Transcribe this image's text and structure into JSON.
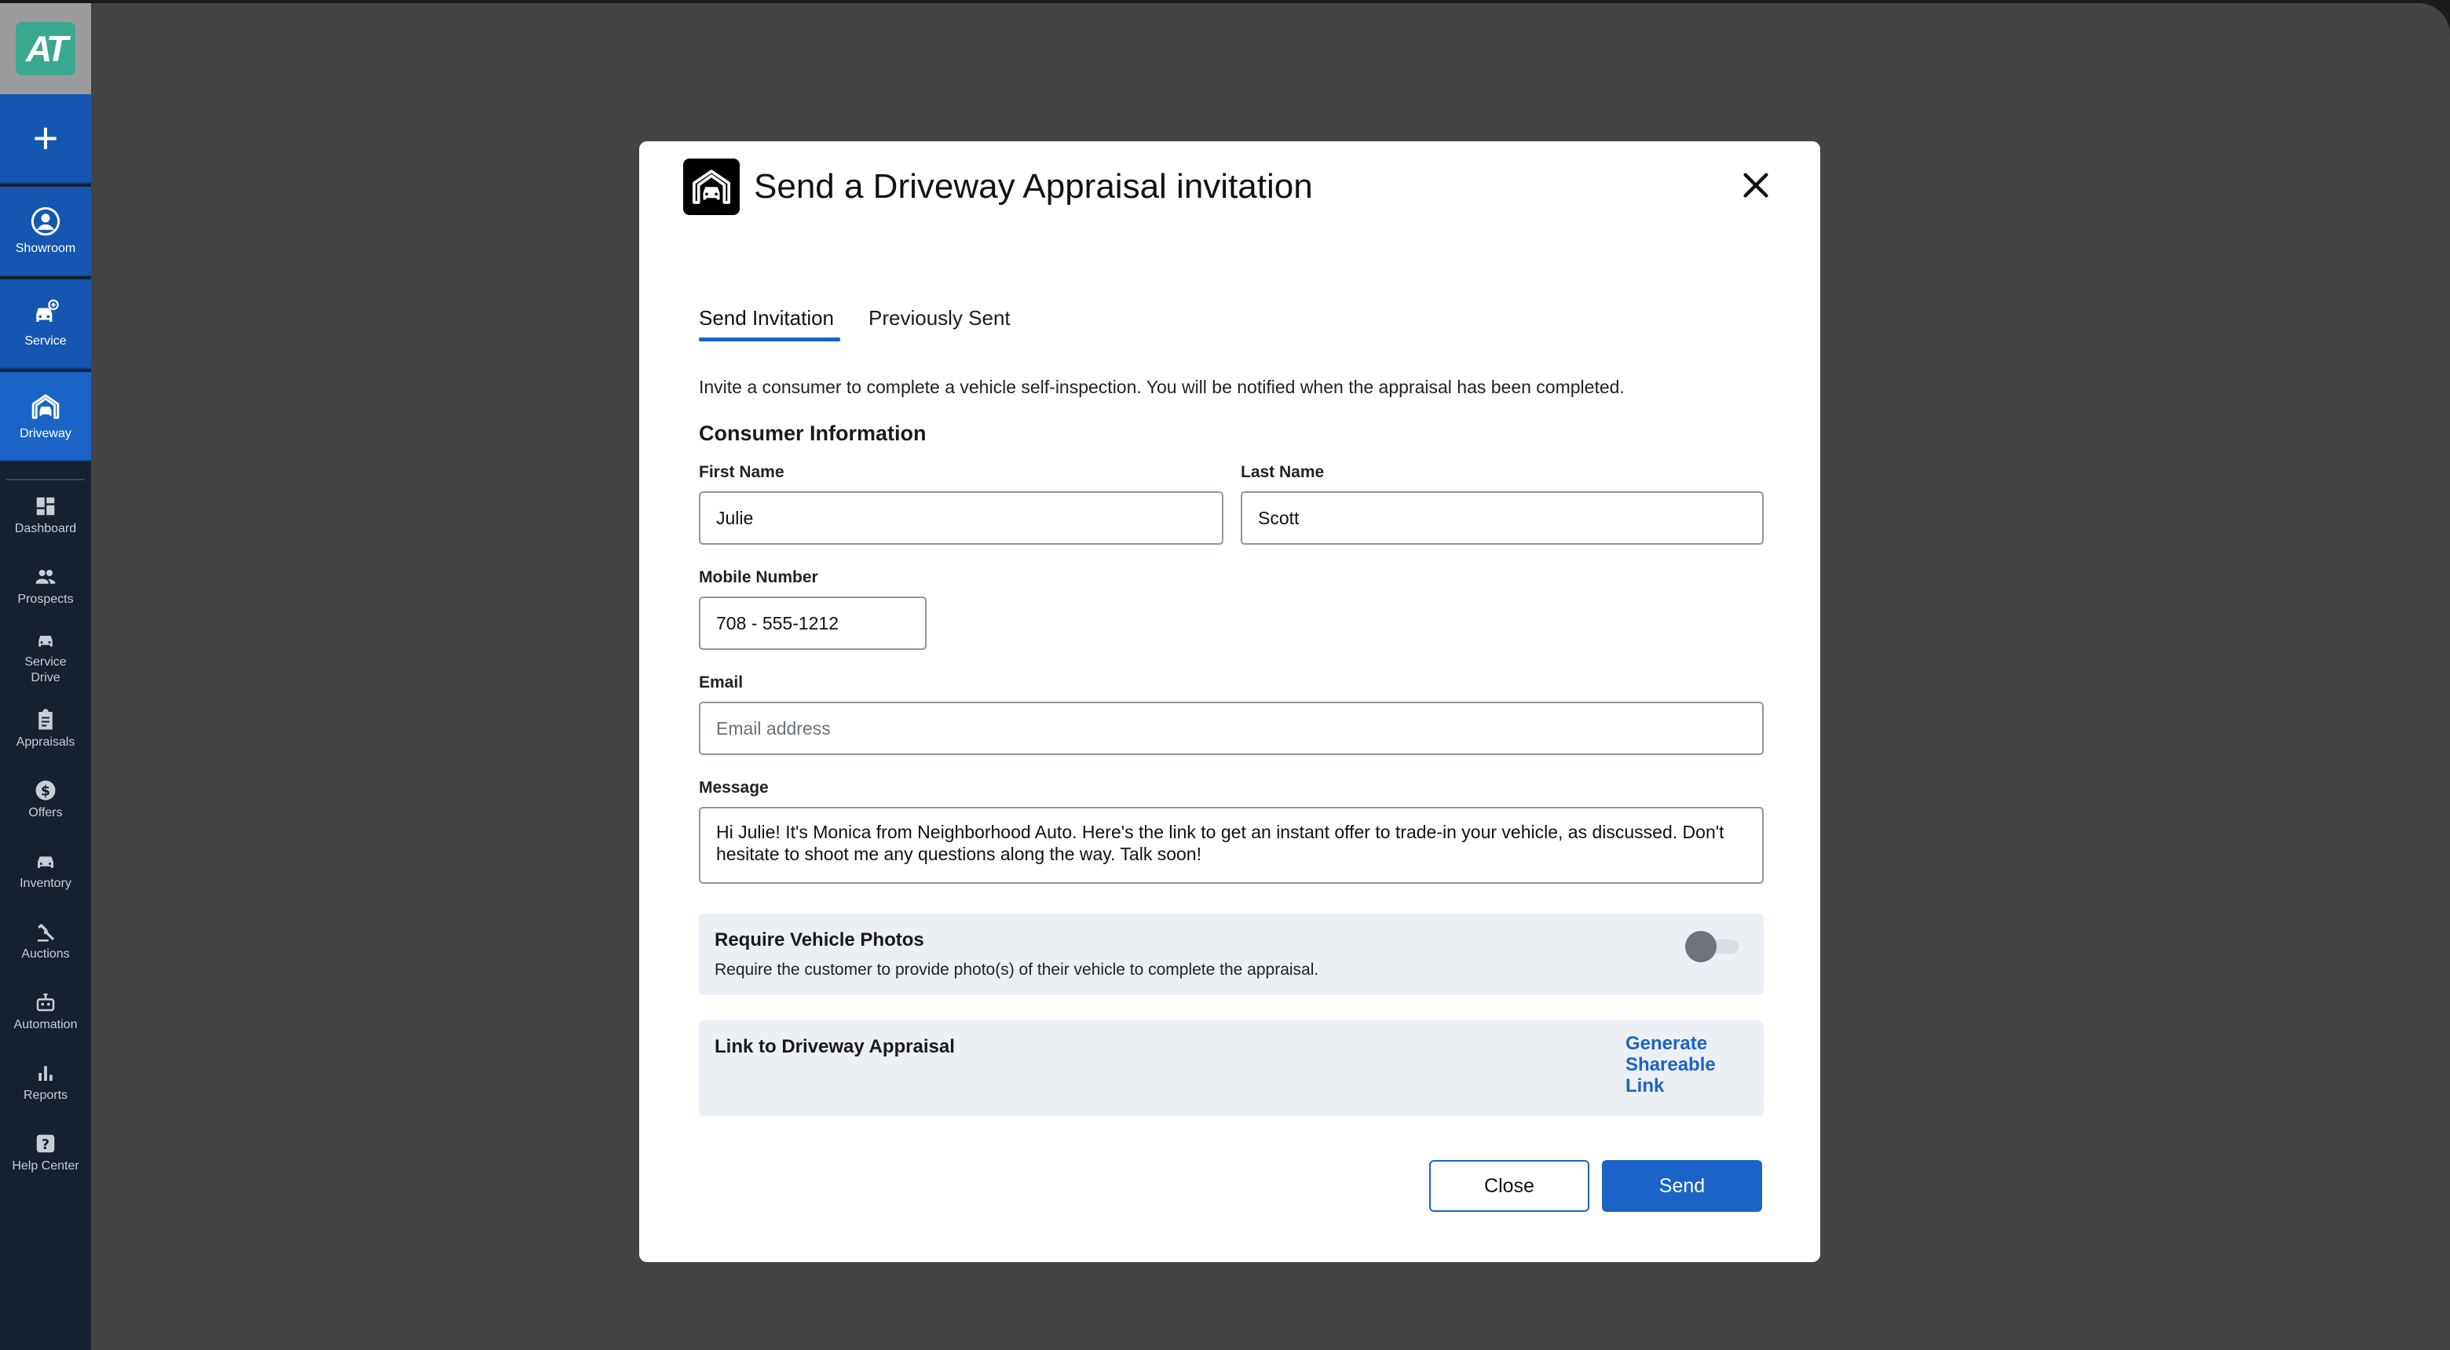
{
  "sidebar": {
    "logo": "AT",
    "top_items": [
      {
        "label": "",
        "icon": "plus-icon"
      },
      {
        "label": "Showroom",
        "icon": "person-circle-icon"
      },
      {
        "label": "Service",
        "icon": "car-service-icon"
      },
      {
        "label": "Driveway",
        "icon": "garage-icon"
      }
    ],
    "nav_items": [
      {
        "label": "Dashboard",
        "icon": "dashboard-icon"
      },
      {
        "label": "Prospects",
        "icon": "people-icon"
      },
      {
        "label": "Service Drive",
        "icon": "car-icon"
      },
      {
        "label": "Appraisals",
        "icon": "clipboard-icon"
      },
      {
        "label": "Offers",
        "icon": "dollar-icon"
      },
      {
        "label": "Inventory",
        "icon": "car-side-icon"
      },
      {
        "label": "Auctions",
        "icon": "gavel-icon"
      },
      {
        "label": "Automation",
        "icon": "robot-icon"
      },
      {
        "label": "Reports",
        "icon": "bar-chart-icon"
      },
      {
        "label": "Help Center",
        "icon": "help-icon"
      }
    ]
  },
  "modal": {
    "title": "Send a Driveway Appraisal invitation",
    "tabs": [
      {
        "label": "Send Invitation",
        "active": true
      },
      {
        "label": "Previously Sent",
        "active": false
      }
    ],
    "intro": "Invite a consumer to complete a vehicle self-inspection. You will be notified when the appraisal has been completed.",
    "section_title": "Consumer Information",
    "fields": {
      "first_name": {
        "label": "First Name",
        "value": "Julie"
      },
      "last_name": {
        "label": "Last Name",
        "value": "Scott"
      },
      "mobile": {
        "label": "Mobile Number",
        "value": "708 - 555-1212"
      },
      "email": {
        "label": "Email",
        "value": "",
        "placeholder": "Email address"
      },
      "message": {
        "label": "Message",
        "value": "Hi Julie! It's Monica from Neighborhood Auto. Here's the link to get an instant offer to trade-in your vehicle, as discussed. Don't hesitate to shoot me any questions along the way. Talk soon!"
      }
    },
    "photos_panel": {
      "title": "Require Vehicle Photos",
      "subtitle": "Require the customer to provide photo(s) of their vehicle to complete the appraisal.",
      "toggle_on": false
    },
    "link_panel": {
      "title": "Link to Driveway Appraisal",
      "action": "Generate Shareable Link"
    },
    "buttons": {
      "close": "Close",
      "send": "Send"
    }
  },
  "colors": {
    "accent": "#1a64c7",
    "sidebar_bg": "#16202f",
    "overlay": "#444444",
    "logo": "#3aa88f"
  }
}
